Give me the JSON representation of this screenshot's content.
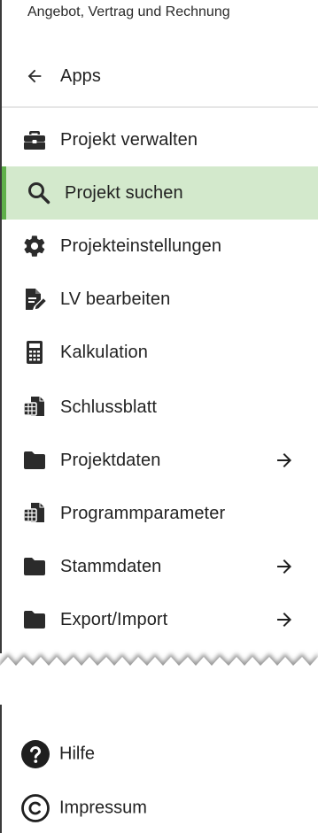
{
  "header": {
    "subtitle": "Angebot, Vertrag und Rechnung"
  },
  "back": {
    "label": "Apps",
    "icon": "arrow-left-icon"
  },
  "menu": {
    "items": [
      {
        "label": "Projekt verwalten",
        "icon": "briefcase-icon",
        "active": false,
        "has_submenu": false
      },
      {
        "label": "Projekt suchen",
        "icon": "search-icon",
        "active": true,
        "has_submenu": false
      },
      {
        "label": "Projekteinstellungen",
        "icon": "gear-icon",
        "active": false,
        "has_submenu": false
      },
      {
        "label": "LV bearbeiten",
        "icon": "file-edit-icon",
        "active": false,
        "has_submenu": false
      },
      {
        "label": "Kalkulation",
        "icon": "calculator-icon",
        "active": false,
        "has_submenu": false
      },
      {
        "label": "Schlussblatt",
        "icon": "spreadsheet-files-icon",
        "active": false,
        "has_submenu": false
      },
      {
        "label": "Projektdaten",
        "icon": "folder-icon",
        "active": false,
        "has_submenu": true
      },
      {
        "label": "Programmparameter",
        "icon": "spreadsheet-files-icon",
        "active": false,
        "has_submenu": false
      },
      {
        "label": "Stammdaten",
        "icon": "folder-icon",
        "active": false,
        "has_submenu": true
      },
      {
        "label": "Export/Import",
        "icon": "folder-icon",
        "active": false,
        "has_submenu": true
      }
    ]
  },
  "footer": {
    "items": [
      {
        "label": "Hilfe",
        "icon": "help-circle-icon"
      },
      {
        "label": "Impressum",
        "icon": "copyright-icon"
      }
    ]
  },
  "colors": {
    "active_background": "#d3e9cc",
    "active_accent": "#5fb04a",
    "icon": "#2b2b2b",
    "text": "#222222"
  }
}
